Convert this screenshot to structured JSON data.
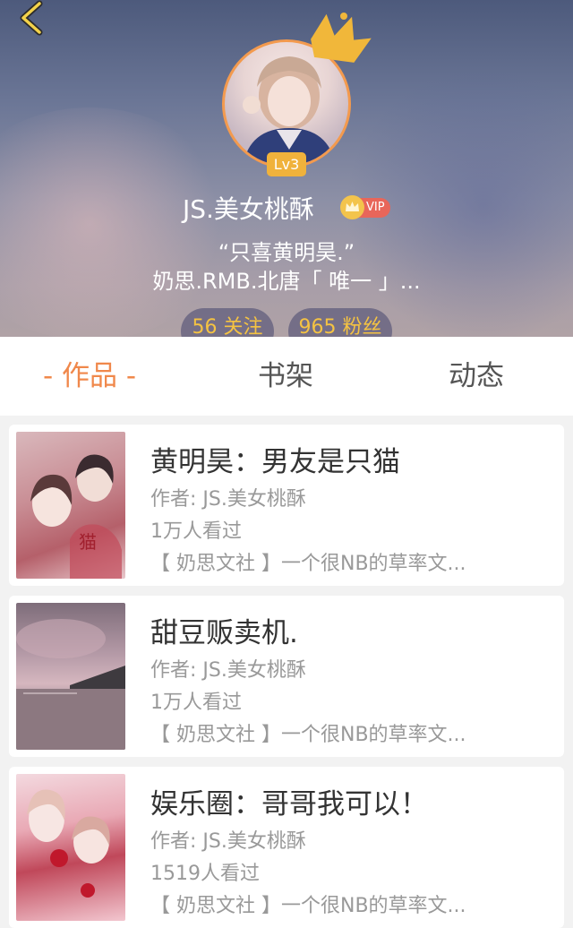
{
  "profile": {
    "level": "Lv3",
    "username": "JS.美女桃酥",
    "vip": "VIP",
    "bio_line1": "“只喜黄明昊.”",
    "bio_line2": "奶思.RMB.北唐「 唯一 」...",
    "follow": "56 关注",
    "fans": "965 粉丝"
  },
  "tabs": [
    {
      "label": "- 作品 -",
      "active": true
    },
    {
      "label": "书架",
      "active": false
    },
    {
      "label": "动态",
      "active": false
    }
  ],
  "books": [
    {
      "title": "黄明昊：男友是只猫",
      "author": "作者: JS.美女桃酥",
      "views": "1万人看过",
      "desc": "【 奶思文社 】一个很NB的草率文..."
    },
    {
      "title": "甜豆贩卖机.",
      "author": "作者: JS.美女桃酥",
      "views": "1万人看过",
      "desc": "【 奶思文社 】一个很NB的草率文..."
    },
    {
      "title": "娱乐圈：哥哥我可以！",
      "author": "作者: JS.美女桃酥",
      "views": "1519人看过",
      "desc": "【 奶思文社 】一个很NB的草率文..."
    }
  ],
  "colors": {
    "accent": "#f0884b",
    "badge": "#f0b23c",
    "stat_text": "#f5c342"
  }
}
